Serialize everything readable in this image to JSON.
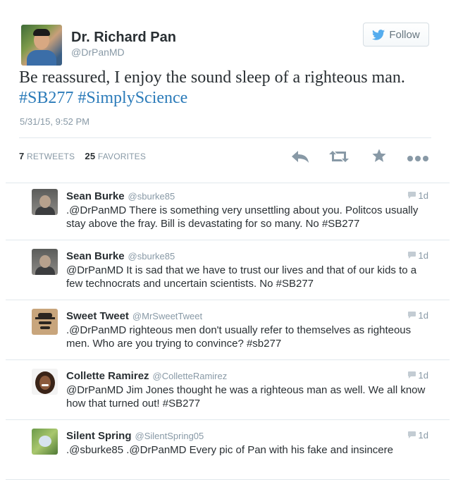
{
  "tweet": {
    "author_name": "Dr. Richard Pan",
    "author_handle": "@DrPanMD",
    "follow_label": "Follow",
    "text_plain": "Be reassured, I enjoy the sound sleep of a righteous man.",
    "hashtags": [
      "#SB277",
      "#SimplyScience"
    ],
    "timestamp": "5/31/15, 9:52 PM",
    "retweets_count": "7",
    "retweets_label": "RETWEETS",
    "favorites_count": "25",
    "favorites_label": "FAVORITES"
  },
  "actions": [
    {
      "name": "reply-icon"
    },
    {
      "name": "retweet-icon"
    },
    {
      "name": "favorite-icon"
    },
    {
      "name": "more-icon"
    }
  ],
  "replies": [
    {
      "name": "Sean Burke",
      "handle": "@sburke85",
      "time": "1d",
      "text": ".@DrPanMD There is something very unsettling about you. Politcos usually stay above the fray. Bill is devastating for so many. No #SB277",
      "avatar": "sean"
    },
    {
      "name": "Sean Burke",
      "handle": "@sburke85",
      "time": "1d",
      "text": "@DrPanMD It is sad that we have to trust our lives and that of our kids to a few technocrats and uncertain scientists. No #SB277",
      "avatar": "sean"
    },
    {
      "name": "Sweet Tweet",
      "handle": "@MrSweetTweet",
      "time": "1d",
      "text": ".@DrPanMD righteous men don't usually refer to themselves as righteous men. Who are you trying to convince? #sb277",
      "avatar": "sweet"
    },
    {
      "name": "Collette Ramirez",
      "handle": "@ColletteRamirez",
      "time": "1d",
      "text": "@DrPanMD Jim Jones thought he was a righteous man as well. We all know how that turned out! #SB277",
      "avatar": "collette"
    },
    {
      "name": "Silent Spring",
      "handle": "@SilentSpring05",
      "time": "1d",
      "text": ".@sburke85 .@DrPanMD Every pic of Pan with his fake and insincere",
      "avatar": "silent"
    }
  ],
  "colors": {
    "link": "#2b7bb9",
    "muted": "#8899a6",
    "text": "#292f33",
    "border": "#e1e8ed",
    "icon": "#8899a6"
  }
}
